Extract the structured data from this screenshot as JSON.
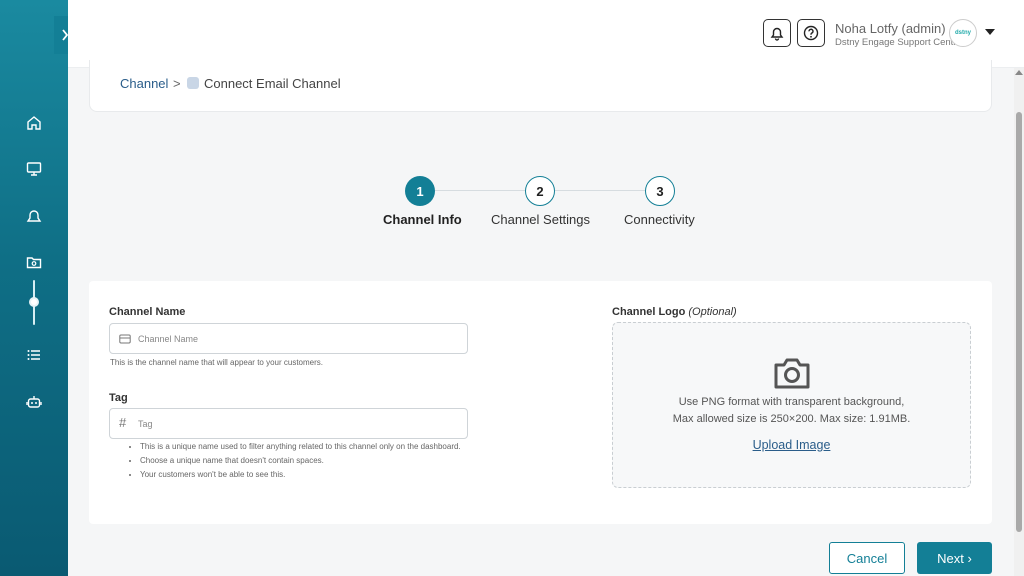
{
  "header": {
    "user_name": "Noha Lotfy (admin)",
    "user_org": "Dstny Engage Support Centre",
    "avatar_text": "dstny",
    "icons": [
      "bell-icon",
      "help-icon"
    ]
  },
  "sidebar": {
    "items": [
      "home-icon",
      "monitor-icon",
      "alert-icon",
      "folder-icon",
      "list-icon",
      "bot-icon"
    ]
  },
  "breadcrumb": {
    "parent": "Channel",
    "separator": ">",
    "current": "Connect Email Channel"
  },
  "steps": [
    {
      "number": "1",
      "label": "Channel Info"
    },
    {
      "number": "2",
      "label": "Channel Settings"
    },
    {
      "number": "3",
      "label": "Connectivity"
    }
  ],
  "form": {
    "channel_name": {
      "label": "Channel Name",
      "placeholder": "Channel Name",
      "hint": "This is the channel name that will appear to your customers."
    },
    "tag": {
      "label": "Tag",
      "placeholder": "Tag",
      "hints": [
        "This is a unique name used to filter anything related to this channel only on the dashboard.",
        "Choose a unique name that doesn't contain spaces.",
        "Your customers won't be able to see this."
      ]
    },
    "logo": {
      "label": "Channel Logo",
      "optional": "(Optional)",
      "line1": "Use PNG format with transparent background,",
      "line2": "Max allowed size is 250×200. Max size: 1.91MB.",
      "upload_label": "Upload Image"
    }
  },
  "footer": {
    "cancel_label": "Cancel",
    "next_label": "Next ›"
  },
  "colors": {
    "primary": "#137f96",
    "sidebar_top": "#1a8aa0",
    "sidebar_bottom": "#0a5a72"
  }
}
